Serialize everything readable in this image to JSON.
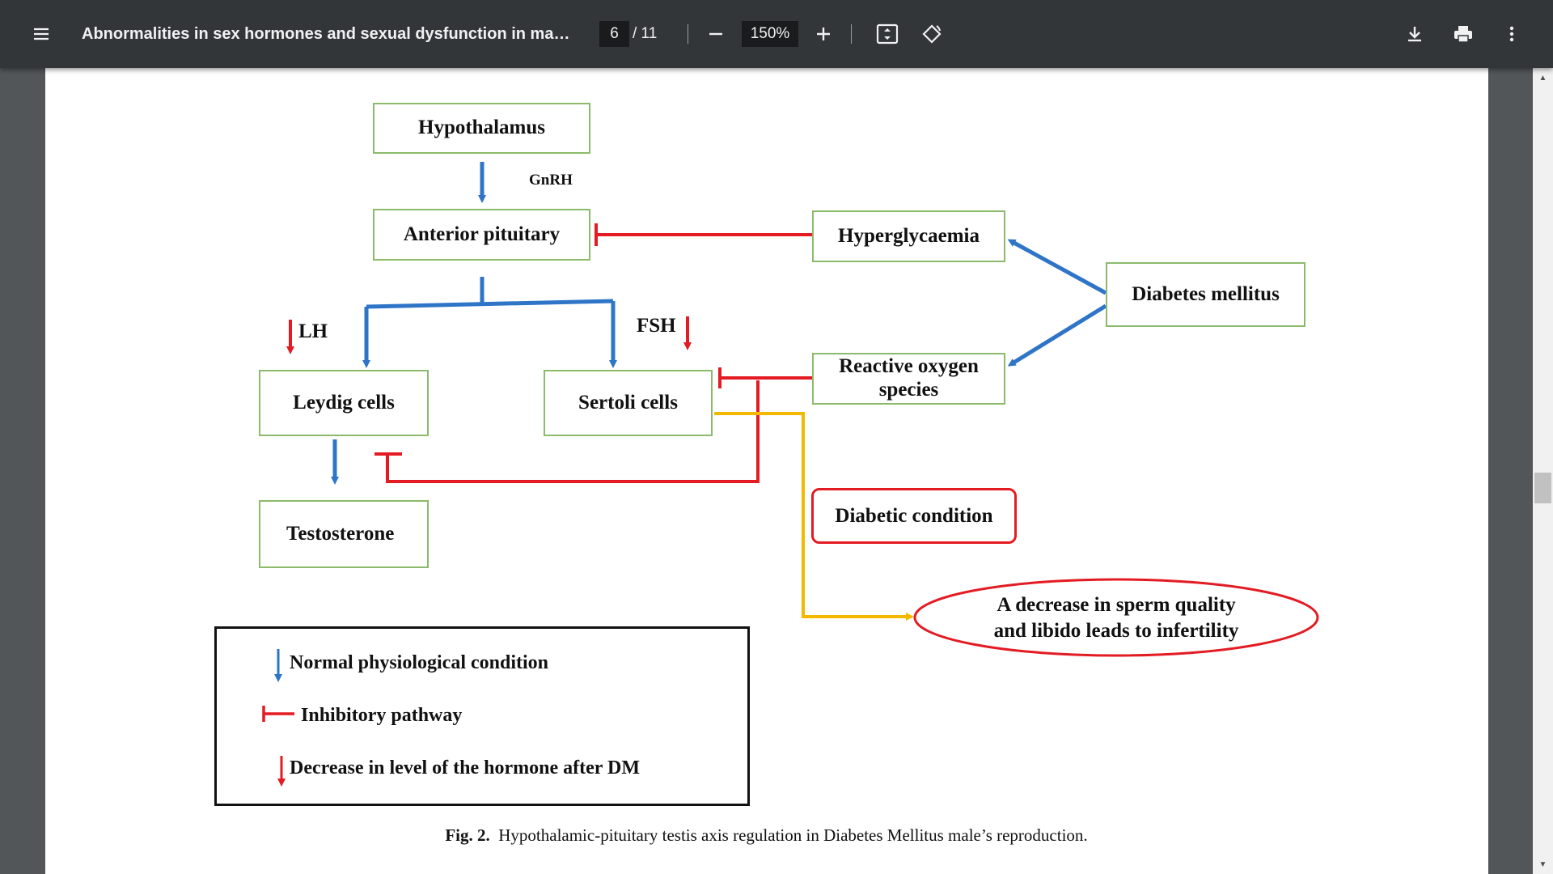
{
  "viewer": {
    "title": "Abnormalities in sex hormones and sexual dysfunction in male...",
    "page_current": "6",
    "page_total": "/ 11",
    "zoom": "150%",
    "icons": {
      "menu": "menu-icon",
      "zoom_out": "minus-icon",
      "zoom_in": "plus-icon",
      "fit": "fit-page-icon",
      "rotate": "rotate-icon",
      "download": "download-icon",
      "print": "print-icon",
      "more": "more-vert-icon"
    },
    "colors": {
      "toolbar": "#323639",
      "background": "#525659"
    }
  },
  "figure": {
    "boxes": {
      "hypothalamus": "Hypothalamus",
      "anterior_pituitary": "Anterior pituitary",
      "hyperglycaemia": "Hyperglycaemia",
      "diabetes_mellitus": "Diabetes mellitus",
      "reactive_oxygen_line1": "Reactive oxygen",
      "reactive_oxygen_line2": "species",
      "leydig": "Leydig cells",
      "sertoli": "Sertoli cells",
      "testosterone": "Testosterone",
      "diabetic_condition": "Diabetic condition",
      "outcome_line1": "A decrease in sperm quality",
      "outcome_line2": "and libido leads to infertility"
    },
    "labels": {
      "gnrh": "GnRH",
      "lh": "LH",
      "fsh": "FSH"
    },
    "legend": {
      "normal": "Normal physiological condition",
      "inhibitory": "Inhibitory pathway",
      "decrease": "Decrease in level of the hormone after DM"
    },
    "caption": {
      "label": "Fig. 2.",
      "text": "Hypothalamic-pituitary testis axis regulation in Diabetes Mellitus male’s reproduction."
    },
    "colors": {
      "normal_arrow": "#2e75c8",
      "inhibitory": "#e31b23",
      "decrease_arrow": "#e31b23",
      "yellow_pathway": "#f5b800",
      "box_border": "#8bbb6a"
    }
  }
}
